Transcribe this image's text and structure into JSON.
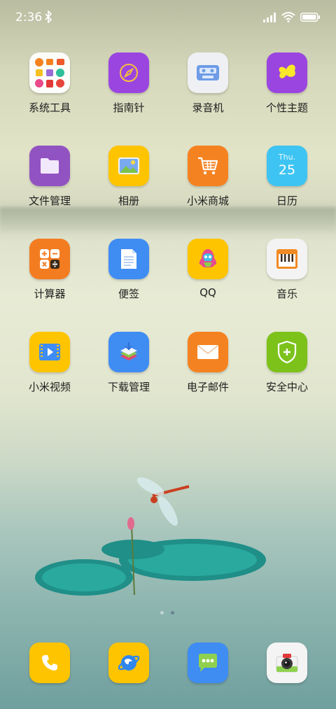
{
  "status": {
    "time": "2:36"
  },
  "apps": [
    {
      "label": "系统工具",
      "icon": "folder-grid-icon"
    },
    {
      "label": "指南针",
      "icon": "compass-icon",
      "color": "#9b45e0"
    },
    {
      "label": "录音机",
      "icon": "recorder-icon",
      "color": "#eef0f3"
    },
    {
      "label": "个性主题",
      "icon": "butterfly-icon",
      "color": "#9b45e0"
    },
    {
      "label": "文件管理",
      "icon": "folder-icon",
      "color": "#9253c2"
    },
    {
      "label": "相册",
      "icon": "gallery-icon",
      "color": "#ffc400"
    },
    {
      "label": "小米商城",
      "icon": "cart-icon",
      "color": "#f58220"
    },
    {
      "label": "日历",
      "icon": "calendar-icon",
      "color": "#3ec4f2",
      "day": "Thu.",
      "date": "25"
    },
    {
      "label": "计算器",
      "icon": "calculator-icon",
      "color": "#f37c21"
    },
    {
      "label": "便签",
      "icon": "note-icon",
      "color": "#3f8cf3"
    },
    {
      "label": "QQ",
      "icon": "qq-icon",
      "color": "#ffc400"
    },
    {
      "label": "音乐",
      "icon": "piano-icon",
      "color": "#f3f3f3"
    },
    {
      "label": "小米视频",
      "icon": "video-icon",
      "color": "#ffc400"
    },
    {
      "label": "下载管理",
      "icon": "download-icon",
      "color": "#3f8cf3"
    },
    {
      "label": "电子邮件",
      "icon": "mail-icon",
      "color": "#f58220"
    },
    {
      "label": "安全中心",
      "icon": "shield-icon",
      "color": "#7cc21b"
    }
  ],
  "dock": [
    {
      "icon": "phone-icon",
      "color": "#ffc400"
    },
    {
      "icon": "browser-icon",
      "color": "#ffc400"
    },
    {
      "icon": "messages-icon",
      "color": "#3f8cf3"
    },
    {
      "icon": "camera-icon",
      "color": "#f4f4f4"
    }
  ]
}
